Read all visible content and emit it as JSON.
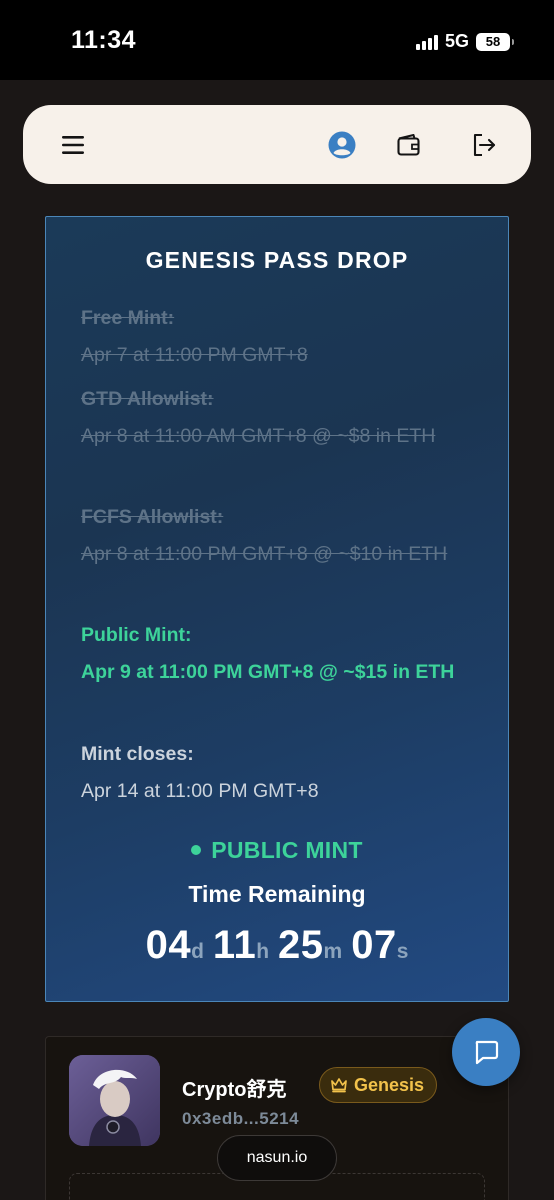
{
  "status_bar": {
    "time": "11:34",
    "network": "5G",
    "battery": "58"
  },
  "header": {
    "menu_icon": "hamburger-menu-icon",
    "profile_icon": "user-circle-icon",
    "wallet_icon": "wallet-icon",
    "logout_icon": "logout-icon"
  },
  "drop": {
    "title": "GENESIS PASS DROP",
    "phases": [
      {
        "label": "Free Mint:",
        "value": "Apr 7 at 11:00 PM GMT+8",
        "state": "done"
      },
      {
        "label": "GTD Allowlist:",
        "value": "Apr 8 at 11:00 AM GMT+8 @ ~$8 in ETH",
        "state": "done"
      },
      {
        "label": "FCFS Allowlist:",
        "value": "Apr 8 at 11:00 PM GMT+8 @ ~$10 in ETH",
        "state": "done"
      },
      {
        "label": "Public Mint:",
        "value": "Apr 9 at 11:00 PM GMT+8 @ ~$15 in ETH",
        "state": "active"
      }
    ],
    "closes": {
      "label": "Mint closes:",
      "value": "Apr 14 at 11:00 PM GMT+8"
    },
    "live_status": "PUBLIC MINT",
    "time_remaining_label": "Time Remaining",
    "countdown": {
      "days": "04",
      "days_unit": "d",
      "hours": "11",
      "hours_unit": "h",
      "minutes": "25",
      "minutes_unit": "m",
      "seconds": "07",
      "seconds_unit": "s"
    }
  },
  "profile": {
    "name": "Crypto舒克",
    "badge": "Genesis",
    "badge_icon": "crown-icon",
    "address": "0x3edb...5214"
  },
  "chat_icon": "chat-bubble-icon",
  "url": "nasun.io",
  "colors": {
    "accent_green": "#3dd39a",
    "panel_border": "#4b86b8",
    "badge_gold": "#f2c24b",
    "chat_blue": "#3a7fc3"
  }
}
